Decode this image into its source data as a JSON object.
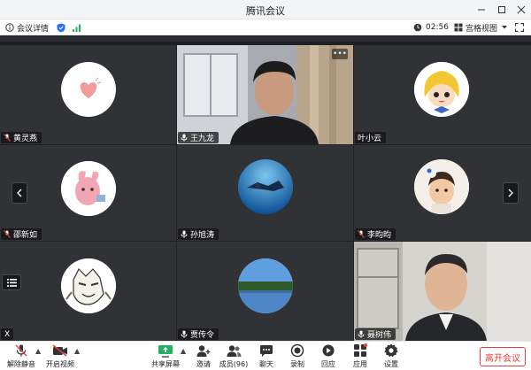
{
  "window": {
    "title": "腾讯会议"
  },
  "infobar": {
    "meeting_details": "会议详情",
    "timer": "02:56",
    "view_mode": "宫格视图"
  },
  "participants": [
    {
      "name": "黄灵燕",
      "avatar": "heart-avatar"
    },
    {
      "name": "王九龙",
      "avatar": "video"
    },
    {
      "name": "叶小云",
      "avatar": "cartoon-girl-avatar"
    },
    {
      "name": "邵新如",
      "avatar": "pink-animal-avatar"
    },
    {
      "name": "孙旭涛",
      "avatar": "underwater-avatar"
    },
    {
      "name": "李昀昀",
      "avatar": "baby-photo-avatar"
    },
    {
      "name": "X",
      "avatar": "mascot-avatar"
    },
    {
      "name": "贾传令",
      "avatar": "lake-avatar"
    },
    {
      "name": "聂树伟",
      "avatar": "video"
    }
  ],
  "toolbar": {
    "unmute": "解除静音",
    "start_video": "开启视频",
    "share_screen": "共享屏幕",
    "invite": "邀请",
    "members": "成员(96)",
    "chat": "聊天",
    "record": "录制",
    "replay": "回应",
    "apps": "应用",
    "settings": "设置",
    "leave": "离开会议"
  },
  "colors": {
    "accent": "#1e6fff",
    "leave": "#e0433b",
    "tile": "#313236",
    "signal": "#22b35e"
  }
}
